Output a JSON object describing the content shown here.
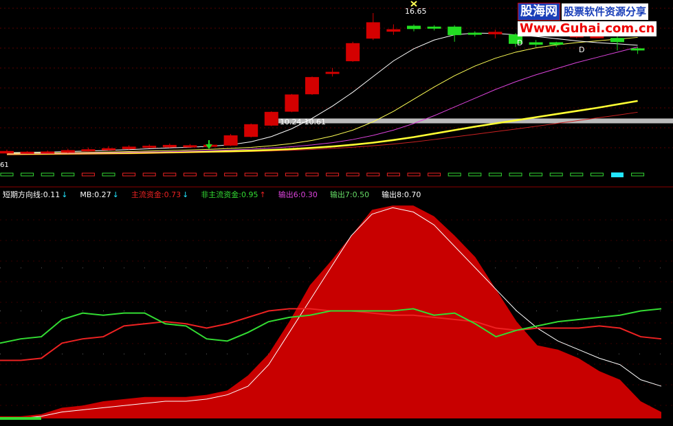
{
  "watermark": {
    "brand": "股海网",
    "slogan": "股票软件资源分享",
    "url": "Www.Guhai.com.cn"
  },
  "colors": {
    "up": "#d40000",
    "down": "#22dd22",
    "ma_white": "#ffffff",
    "ma_yellow": "#ffff55",
    "ma_magenta": "#dd44dd",
    "ma_thick": "#ffff33",
    "ma_red": "#cc2222",
    "band": "#bbbbbb",
    "area_fill": "#c80000",
    "main_fund": "#ee2222",
    "nonmain_fund": "#33dd33",
    "output6": "#dd44dd",
    "output7": "#66dd66",
    "output8": "#ffffff",
    "cyan": "#22e5ff"
  },
  "legend": [
    {
      "label": "短期方向线:0.11",
      "arrow": "↓",
      "color": "#ffffff",
      "arrow_color": "#22e5ff"
    },
    {
      "label": "MB:0.27",
      "arrow": "↓",
      "color": "#ffffff",
      "arrow_color": "#22e5ff"
    },
    {
      "label": "主流资金:0.73",
      "arrow": "↓",
      "color": "#ee2222",
      "arrow_color": "#22e5ff"
    },
    {
      "label": "非主流资金:0.95",
      "arrow": "↑",
      "color": "#33dd33",
      "arrow_color": "#ee2222"
    },
    {
      "label": "输出6:0.30",
      "arrow": "",
      "color": "#dd44dd",
      "arrow_color": ""
    },
    {
      "label": "输出7:0.50",
      "arrow": "",
      "color": "#66dd66",
      "arrow_color": ""
    },
    {
      "label": "输出8:0.70",
      "arrow": "",
      "color": "#ffffff",
      "arrow_color": ""
    }
  ],
  "price_labels": {
    "high": "16.65",
    "band": "10.24-10.61",
    "left_edge": "61",
    "d1": "D",
    "d2": "D"
  },
  "chart_data": [
    {
      "type": "candlestick",
      "ylim": [
        8,
        17.4
      ],
      "candles": [
        {
          "o": 8.6,
          "c": 8.7,
          "h": 8.8,
          "l": 8.55
        },
        {
          "o": 8.62,
          "c": 8.66,
          "h": 8.72,
          "l": 8.56
        },
        {
          "o": 8.63,
          "c": 8.67,
          "h": 8.75,
          "l": 8.58
        },
        {
          "o": 8.64,
          "c": 8.75,
          "h": 8.85,
          "l": 8.6
        },
        {
          "o": 8.72,
          "c": 8.8,
          "h": 8.92,
          "l": 8.68
        },
        {
          "o": 8.78,
          "c": 8.86,
          "h": 9.0,
          "l": 8.74
        },
        {
          "o": 8.85,
          "c": 8.95,
          "h": 9.05,
          "l": 8.8
        },
        {
          "o": 8.92,
          "c": 9.0,
          "h": 9.1,
          "l": 8.88
        },
        {
          "o": 8.95,
          "c": 9.05,
          "h": 9.15,
          "l": 8.9
        },
        {
          "o": 9.0,
          "c": 9.03,
          "h": 9.12,
          "l": 8.94
        },
        {
          "o": 9.02,
          "c": 9.06,
          "h": 9.14,
          "l": 8.96
        },
        {
          "o": 9.05,
          "c": 9.6,
          "h": 9.7,
          "l": 9.0
        },
        {
          "o": 9.55,
          "c": 10.24,
          "h": 10.3,
          "l": 9.5
        },
        {
          "o": 10.2,
          "c": 10.95,
          "h": 11.0,
          "l": 10.15
        },
        {
          "o": 11.0,
          "c": 11.95,
          "h": 12.0,
          "l": 10.95
        },
        {
          "o": 12.0,
          "c": 12.95,
          "h": 13.0,
          "l": 11.95
        },
        {
          "o": 13.2,
          "c": 13.25,
          "h": 13.5,
          "l": 13.0
        },
        {
          "o": 13.9,
          "c": 14.9,
          "h": 15.0,
          "l": 13.85
        },
        {
          "o": 15.2,
          "c": 16.1,
          "h": 16.65,
          "l": 15.1
        },
        {
          "o": 15.6,
          "c": 15.7,
          "h": 16.0,
          "l": 15.4
        },
        {
          "o": 15.9,
          "c": 15.75,
          "h": 16.0,
          "l": 15.6
        },
        {
          "o": 15.85,
          "c": 15.8,
          "h": 15.95,
          "l": 15.65
        },
        {
          "o": 15.85,
          "c": 15.4,
          "h": 15.95,
          "l": 15.0
        },
        {
          "o": 15.5,
          "c": 15.45,
          "h": 15.6,
          "l": 15.3
        },
        {
          "o": 15.45,
          "c": 15.55,
          "h": 15.7,
          "l": 15.2
        },
        {
          "o": 15.4,
          "c": 14.9,
          "h": 15.5,
          "l": 14.7
        },
        {
          "o": 14.95,
          "c": 14.85,
          "h": 15.1,
          "l": 14.7
        },
        {
          "o": 14.95,
          "c": 14.85,
          "h": 15.0,
          "l": 14.7
        },
        {
          "o": 15.3,
          "c": 15.35,
          "h": 15.5,
          "l": 15.2
        },
        {
          "o": 15.3,
          "c": 15.3,
          "h": 15.4,
          "l": 15.2
        },
        {
          "o": 15.2,
          "c": 15.0,
          "h": 15.3,
          "l": 14.5
        },
        {
          "o": 14.6,
          "c": 14.55,
          "h": 14.7,
          "l": 14.3
        }
      ],
      "ma_white": [
        8.62,
        8.64,
        8.66,
        8.69,
        8.72,
        8.76,
        8.8,
        8.85,
        8.9,
        8.94,
        8.99,
        9.08,
        9.25,
        9.55,
        10.0,
        10.6,
        11.3,
        12.1,
        13.0,
        13.9,
        14.6,
        15.1,
        15.4,
        15.5,
        15.48,
        15.4,
        15.3,
        15.18,
        15.05,
        14.95,
        14.88,
        14.8
      ],
      "ma_yellow": [
        8.58,
        8.59,
        8.6,
        8.62,
        8.64,
        8.66,
        8.69,
        8.72,
        8.75,
        8.78,
        8.82,
        8.87,
        8.93,
        9.02,
        9.15,
        9.33,
        9.58,
        9.92,
        10.4,
        11.0,
        11.7,
        12.4,
        13.05,
        13.6,
        14.05,
        14.4,
        14.65,
        14.82,
        14.95,
        15.05,
        15.15,
        15.25
      ],
      "ma_magenta": [
        8.56,
        8.57,
        8.58,
        8.59,
        8.6,
        8.62,
        8.64,
        8.66,
        8.68,
        8.71,
        8.74,
        8.78,
        8.83,
        8.89,
        8.97,
        9.07,
        9.2,
        9.38,
        9.62,
        9.92,
        10.3,
        10.75,
        11.25,
        11.75,
        12.25,
        12.7,
        13.1,
        13.45,
        13.8,
        14.1,
        14.4,
        14.7
      ],
      "ma_thick": [
        8.55,
        8.56,
        8.57,
        8.58,
        8.59,
        8.6,
        8.61,
        8.63,
        8.65,
        8.67,
        8.69,
        8.71,
        8.74,
        8.78,
        8.83,
        8.9,
        8.98,
        9.08,
        9.2,
        9.35,
        9.52,
        9.72,
        9.92,
        10.12,
        10.3,
        10.48,
        10.66,
        10.84,
        11.02,
        11.2,
        11.4,
        11.6
      ],
      "ma_red": [
        8.5,
        8.51,
        8.52,
        8.53,
        8.54,
        8.55,
        8.56,
        8.58,
        8.6,
        8.62,
        8.64,
        8.66,
        8.69,
        8.72,
        8.76,
        8.81,
        8.87,
        8.94,
        9.02,
        9.12,
        9.24,
        9.38,
        9.53,
        9.68,
        9.83,
        9.98,
        10.14,
        10.3,
        10.46,
        10.62,
        10.78,
        10.95
      ],
      "band_price": 10.45,
      "signal_strip": [
        "g",
        "g",
        "g",
        "g",
        "r",
        "g",
        "r",
        "r",
        "r",
        "r",
        "r",
        "r",
        "r",
        "r",
        "r",
        "r",
        "r",
        "r",
        "r",
        "r",
        "r",
        "r",
        "g",
        "g",
        "g",
        "g",
        "g",
        "g",
        "g",
        "g",
        "c",
        "g"
      ]
    },
    {
      "type": "area",
      "ylim": [
        0,
        1
      ],
      "x": [
        0,
        1,
        2,
        3,
        4,
        5,
        6,
        7,
        8,
        9,
        10,
        11,
        12,
        13,
        14,
        15,
        16,
        17,
        18,
        19,
        20,
        21,
        22,
        23,
        24,
        25,
        26,
        27,
        28,
        29,
        30,
        31,
        32
      ],
      "area_series": [
        0.01,
        0.01,
        0.02,
        0.05,
        0.06,
        0.08,
        0.09,
        0.1,
        0.1,
        0.1,
        0.11,
        0.13,
        0.2,
        0.3,
        0.45,
        0.62,
        0.73,
        0.85,
        0.97,
        0.99,
        0.99,
        0.94,
        0.85,
        0.75,
        0.6,
        0.45,
        0.34,
        0.32,
        0.28,
        0.22,
        0.18,
        0.08,
        0.03
      ],
      "series": [
        {
          "name": "短期方向线",
          "values": [
            0.0,
            0.0,
            0.01,
            0.03,
            0.04,
            0.05,
            0.06,
            0.07,
            0.08,
            0.08,
            0.09,
            0.11,
            0.15,
            0.25,
            0.4,
            0.55,
            0.7,
            0.85,
            0.95,
            0.98,
            0.96,
            0.9,
            0.8,
            0.7,
            0.6,
            0.5,
            0.42,
            0.36,
            0.32,
            0.28,
            0.25,
            0.18,
            0.15
          ]
        },
        {
          "name": "主流资金",
          "values": [
            0.27,
            0.27,
            0.28,
            0.35,
            0.37,
            0.38,
            0.43,
            0.44,
            0.45,
            0.44,
            0.42,
            0.44,
            0.47,
            0.5,
            0.51,
            0.51,
            0.5,
            0.5,
            0.49,
            0.48,
            0.48,
            0.47,
            0.46,
            0.45,
            0.42,
            0.41,
            0.42,
            0.42,
            0.42,
            0.43,
            0.42,
            0.38,
            0.37
          ]
        },
        {
          "name": "非主流资金",
          "values": [
            0.35,
            0.37,
            0.38,
            0.46,
            0.49,
            0.48,
            0.49,
            0.49,
            0.44,
            0.43,
            0.37,
            0.36,
            0.4,
            0.45,
            0.47,
            0.48,
            0.5,
            0.5,
            0.5,
            0.5,
            0.51,
            0.48,
            0.49,
            0.44,
            0.38,
            0.41,
            0.43,
            0.45,
            0.46,
            0.47,
            0.48,
            0.5,
            0.51
          ]
        }
      ],
      "levels": [
        0.3,
        0.5,
        0.7
      ]
    }
  ]
}
